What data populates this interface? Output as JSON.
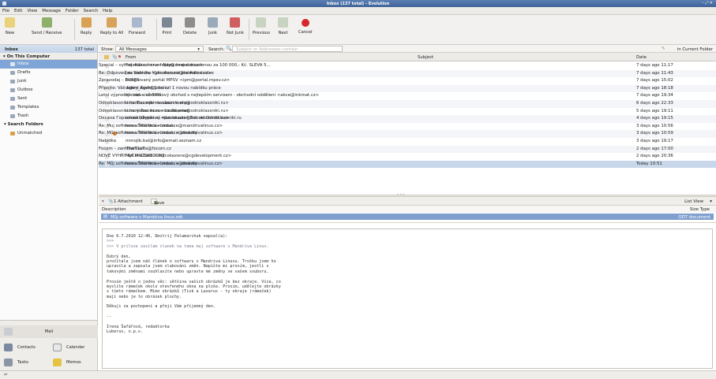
{
  "window": {
    "title": "Inbox (137 total) - Evolution",
    "controls": "– ⤢ ✕"
  },
  "menu": [
    "File",
    "Edit",
    "View",
    "Message",
    "Folder",
    "Search",
    "Help"
  ],
  "toolbar": {
    "new": "New",
    "send_receive": "Send / Receive",
    "reply": "Reply",
    "reply_all": "Reply to All",
    "forward": "Forward",
    "print": "Print",
    "delete": "Delete",
    "junk": "Junk",
    "not_junk": "Not Junk",
    "previous": "Previous",
    "next": "Next",
    "cancel": "Cancel"
  },
  "searchbar": {
    "folder_name": "Inbox",
    "folder_count": "137 total",
    "show_label": "Show:",
    "show_value": "All Messages",
    "search_label": "Search:",
    "search_placeholder": "Subject or Addresses contain",
    "scope_value": "in Current Folder"
  },
  "sidebar": {
    "section_computer": "On This Computer",
    "folders": [
      "Inbox",
      "Drafts",
      "Junk",
      "Outbox",
      "Sent",
      "Templates",
      "Trash"
    ],
    "section_search": "Search Folders",
    "search_folders": [
      "Unmatched"
    ]
  },
  "switcher": {
    "mail": "Mail",
    "contacts": "Contacts",
    "calendar": "Calendar",
    "tasks": "Tasks",
    "memos": "Memos"
  },
  "message_list": {
    "columns": {
      "from": "From",
      "subject": "Subject",
      "date": "Date"
    },
    "rows": [
      {
        "from": "Fotolkar.cz <no-reply@eawedor.cz>",
        "subject": "Special – vyhraj milion korun! Navic hraj o dovolenou za 100 000,- Kč. SLEVA 5...",
        "date": "7 days ago 11:17",
        "flag": ""
      },
      {
        "from": "Jan Stanura <jan.stanura@talentica.cz>",
        "subject": "Re: Odpoved na nabidku Vyhodnoceni pro Autorivstve",
        "date": "7 days ago 11:43",
        "flag": ""
      },
      {
        "from": "Integrovaný portál MPSV <ipm@portal.mpsv.cz>",
        "subject": "Zpravodaj – EURES",
        "date": "7 days ago 15:02",
        "flag": ""
      },
      {
        "from": "dobry_duch@jobs.cz",
        "subject": "Připojte: Váš agent Agent 1 nalezl 1 novou nabídku práce",
        "date": "7 days ago 18:18",
        "flag": ""
      },
      {
        "from": "Inkmat - internetový obchod s nejlepším servisem - obchodní oddělení <akce@inkmat.cz>",
        "subject": "Letní výprodej - sleva až 50%",
        "date": "7 days ago 19:34",
        "flag": ""
      },
      {
        "from": "odnoklassniki.ru <bezotveta@odnoklassniki.ru>",
        "subject": "Odnoklassniki.ru: Вас приглашают в игру",
        "date": "6 days ago 22:33",
        "flag": ""
      },
      {
        "from": "odnoklassniki.ru <bezotveta@odnoklassniki.ru>",
        "subject": "Odnoklassniki.ru: у Вас новое сообщение",
        "date": "5 days ago 19:11",
        "flag": ""
      },
      {
        "from": "odnoklassniki.ru <bezotveta@odnoklassniki.ru>",
        "subject": "Оксана Горюнова (Фурина) приглашает Вас на Odnoklassniki.ru",
        "date": "4 days ago 19:15",
        "flag": ""
      },
      {
        "from": "Irena Šafářová <redakce@mandrivalinux.cz>",
        "subject": "Re: Muj software v Mandriva Linuxu",
        "date": "3 days ago 10:56",
        "flag": ""
      },
      {
        "from": "Irena Šafářová <redakce@mandrivalinux.cz>",
        "subject": "Re: Můj software v Mandriva Linuxu + obrázky",
        "date": "3 days ago 10:59",
        "flag": "orange"
      },
      {
        "from": "mmojib.bal@info@email.seznam.cz",
        "subject": "Nabídka",
        "date": "3 days ago 19:17",
        "flag": ""
      },
      {
        "from": "lmarekova@focom.cz",
        "subject": "Focom – zamTheT1eT",
        "date": "2 days ago 17:00",
        "flag": ""
      },
      {
        "from": "MyCokeZone <mycokezone@cgdevelopment.cz>",
        "subject": "NOVÉ VYHRY NA MYCOKEZONE",
        "date": "2 days ago 20:36",
        "flag": ""
      },
      {
        "from": "Irena Šafářová <redakce@mandrivalinux.cz>",
        "subject": "Re: Můj software v Mandriva Linuxu + obrázky",
        "date": "Today 10:51",
        "flag": ""
      }
    ]
  },
  "attachment_bar": {
    "count_label": "1 Attachment",
    "save_as": "Save As",
    "view_mode": "List View"
  },
  "attachment_list": {
    "col_description": "Description",
    "col_size": "Size Type",
    "item_name": "Můj software v Mandriva linux.odt",
    "item_type": "ODT document"
  },
  "preview": {
    "lines": [
      {
        "t": "Dne 6.7.2010 12:40, Dmitrij Palamarchuk napsal(a):",
        "q": false
      },
      {
        "t": ">>>",
        "q": true
      },
      {
        "t": ">>> V priloze zasilam clanek na tema muj software v Mandriva Linux.",
        "q": true
      },
      {
        "t": "",
        "q": false
      },
      {
        "t": "Dobrý den,",
        "q": false
      },
      {
        "t": "pročítala jsem náš článek o softwaru v Mandriva Linuxu. Trošku jsem ho",
        "q": false
      },
      {
        "t": "upravila a zapsala jsem slabování změn. Napište mi prosím, jestli s",
        "q": false
      },
      {
        "t": "takovými změnami souhlasíte nebo upravte mé změny ve vašem souboru.",
        "q": false
      },
      {
        "t": "",
        "q": false
      },
      {
        "t": "Prosím ještě o jednu věc: většina vašich obrázků je bez okraje. Více, co",
        "q": false
      },
      {
        "t": "myslíte rámeček okolo otevřeného okna na ploše. Prosím, udělejte obrázky",
        "q": false
      },
      {
        "t": "s tímto rámečkem. Mimo obrázků (Tisk a Lazarus - ty okraje (rámeček)",
        "q": false
      },
      {
        "t": "mají nebo je to obrázek plochy.",
        "q": false
      },
      {
        "t": "",
        "q": false
      },
      {
        "t": "Děkuji za pochopení a přeji Vám příjemný den.",
        "q": false
      },
      {
        "t": "",
        "q": false
      },
      {
        "t": "--",
        "q": false
      },
      {
        "t": "",
        "q": false
      },
      {
        "t": "Irena Šafářová, redaktorka",
        "q": false
      },
      {
        "t": "Luberus, o.p.s.",
        "q": false
      }
    ]
  },
  "colors": {
    "selection": "#7fa5d6",
    "title_bar": "#4a6fa6",
    "attachment_row": "#7f9fcf"
  }
}
